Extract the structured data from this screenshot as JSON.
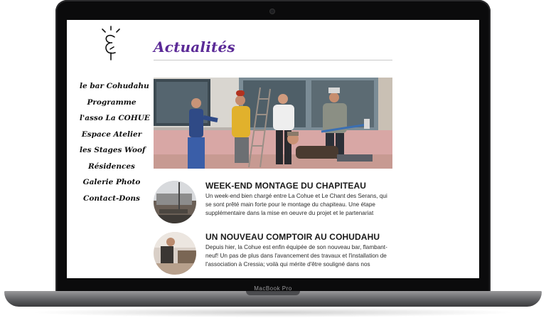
{
  "device": {
    "brand": "MacBook Pro"
  },
  "site": {
    "nav": [
      {
        "label": "le bar Cohudahu"
      },
      {
        "label": "Programme"
      },
      {
        "label": "l'asso La COHUE"
      },
      {
        "label": "Espace Atelier"
      },
      {
        "label": "les Stages Woof"
      },
      {
        "label": "Résidences"
      },
      {
        "label": "Galerie Photo"
      },
      {
        "label": "Contact-Dons"
      }
    ],
    "page_title": "Actualités",
    "posts": [
      {
        "title": "WEEK-END MONTAGE DU CHAPITEAU",
        "excerpt": "Un week-end bien chargé entre La Cohue et Le Chant des Serans, qui se sont prêté main forte pour le montage du chapiteau. Une étape supplémentaire dans la mise en oeuvre du projet et le partenariat"
      },
      {
        "title": "UN NOUVEAU COMPTOIR AU COHUDAHU",
        "excerpt": "Depuis hier, la Cohue est enfin équipée de son nouveau bar, flambant-neuf! Un pas de plus dans l'avancement des travaux et l'installation de l'association à Cressia; voilà qui mérite d'être souligné dans nos"
      }
    ]
  },
  "colors": {
    "title_accent": "#5b2a97",
    "laptop_body": "#0b0b0c"
  }
}
